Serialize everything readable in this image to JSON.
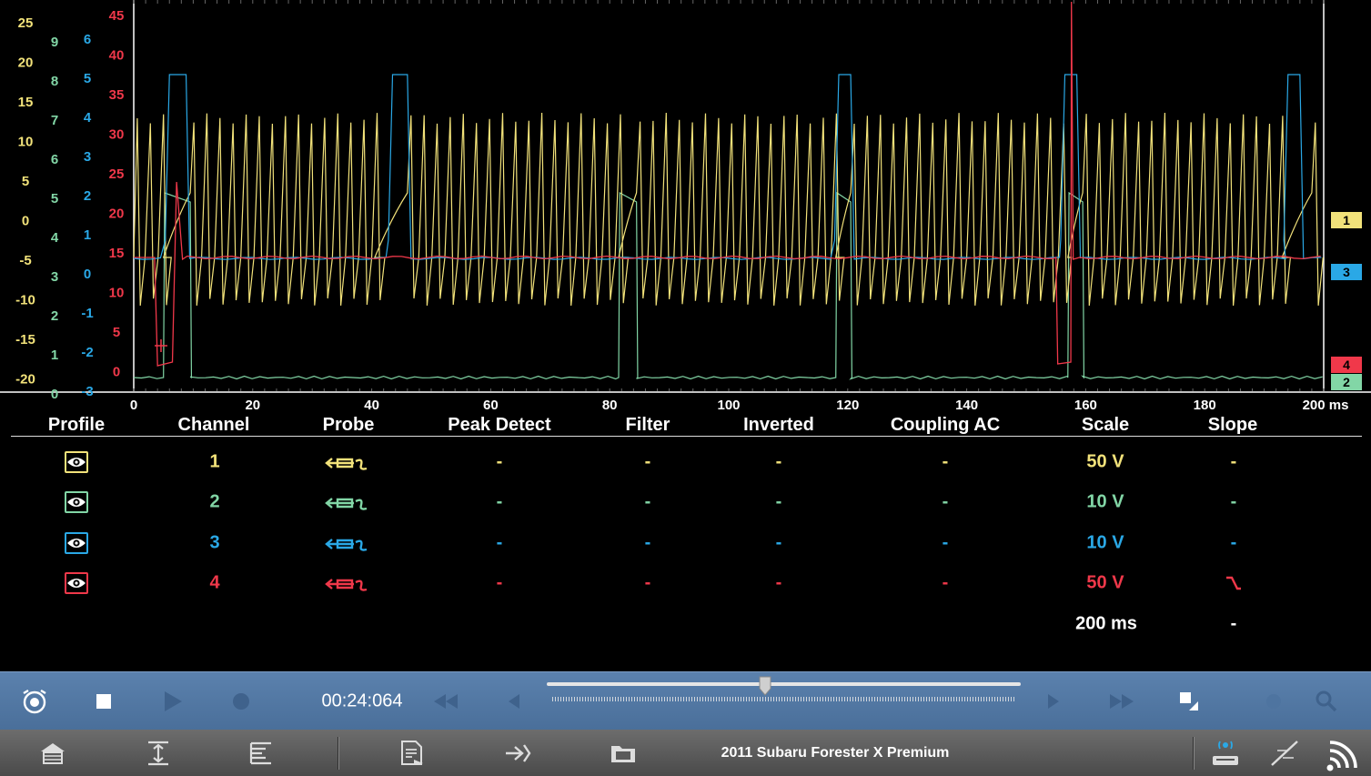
{
  "colors": {
    "ch1": "#f2e27a",
    "ch2": "#82d6a6",
    "ch3": "#2aa8e6",
    "ch4": "#f0384a"
  },
  "scale_labels": {
    "ch1": [
      "25",
      "20",
      "15",
      "10",
      "5",
      "0",
      "-5",
      "-10",
      "-15",
      "-20"
    ],
    "ch2": [
      "9",
      "8",
      "7",
      "6",
      "5",
      "4",
      "3",
      "2",
      "1",
      "0"
    ],
    "ch3": [
      "6",
      "5",
      "4",
      "3",
      "2",
      "1",
      "0",
      "-1",
      "-2",
      "-3"
    ],
    "ch4": [
      "45",
      "40",
      "35",
      "30",
      "25",
      "20",
      "15",
      "10",
      "5",
      "0"
    ]
  },
  "time_axis": {
    "ticks": [
      "0",
      "20",
      "40",
      "60",
      "80",
      "100",
      "120",
      "140",
      "160",
      "180"
    ],
    "end_label": "200 ms"
  },
  "markers": [
    {
      "label": "1",
      "color": "#f2e27a"
    },
    {
      "label": "3",
      "color": "#2aa8e6"
    },
    {
      "label": "4",
      "color": "#f0384a"
    },
    {
      "label": "2",
      "color": "#82d6a6"
    }
  ],
  "table": {
    "headers": [
      "Profile",
      "Channel",
      "Probe",
      "Peak Detect",
      "Filter",
      "Inverted",
      "Coupling AC",
      "Scale",
      "Slope"
    ],
    "rows": [
      {
        "channel": "1",
        "peak": "-",
        "filter": "-",
        "inverted": "-",
        "coupling": "-",
        "scale": "50 V",
        "slope": "-"
      },
      {
        "channel": "2",
        "peak": "-",
        "filter": "-",
        "inverted": "-",
        "coupling": "-",
        "scale": "10 V",
        "slope": "-"
      },
      {
        "channel": "3",
        "peak": "-",
        "filter": "-",
        "inverted": "-",
        "coupling": "-",
        "scale": "10 V",
        "slope": "-"
      },
      {
        "channel": "4",
        "peak": "-",
        "filter": "-",
        "inverted": "-",
        "coupling": "-",
        "scale": "50 V",
        "slope": "falling-edge-icon"
      }
    ],
    "time_row": {
      "scale": "200 ms",
      "slope": "-"
    }
  },
  "toolbar": {
    "timestamp": "00:24:064",
    "playback_position": 0.46
  },
  "status": {
    "vehicle": "2011 Subaru Forester X Premium"
  }
}
